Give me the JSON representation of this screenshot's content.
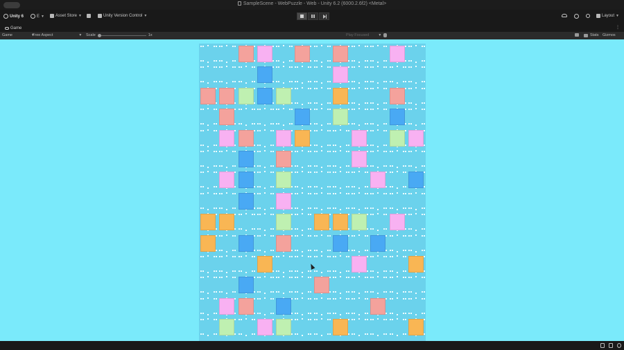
{
  "titlebar": {
    "title": "SampleScene - WebPuzzle - Web - Unity 6.2 (6000.2.6f2) <Metal>"
  },
  "toolbar": {
    "account": "Unity 6",
    "user": "E",
    "asset_store": "Asset Store",
    "version_control": "Unity Version Control",
    "layout": "Layout"
  },
  "tab": {
    "game": "Game"
  },
  "gamebar": {
    "display": "Game",
    "aspect": "Free Aspect",
    "scale_label": "Scale",
    "scale_value": "1x",
    "play_focused": "Play Focused",
    "stats": "Stats",
    "gizmos": "Gizmos"
  },
  "board": {
    "cols": 12,
    "rows": 14,
    "colors": {
      "R": "#f4a29c",
      "P": "#f8b1f2",
      "B": "#49a9f4",
      "G": "#bff0b1",
      "O": "#f9b654",
      "cell": "#6bd2ec",
      "background": "#7aeafb"
    },
    "grid": [
      "..RP.R.R..P.",
      "...B...P....",
      "RRGBG..O..R.",
      ".R...B.G..B.",
      ".PR.PO..P.GP",
      "..B.R...P...",
      ".PB.G....P.B",
      "..B.P.......",
      "OO..G.OOG.P.",
      "O.B.R..B.B..",
      "...O....P..O",
      "..B...R.....",
      ".PR.B....R..",
      ".G.PG..O...O"
    ]
  }
}
